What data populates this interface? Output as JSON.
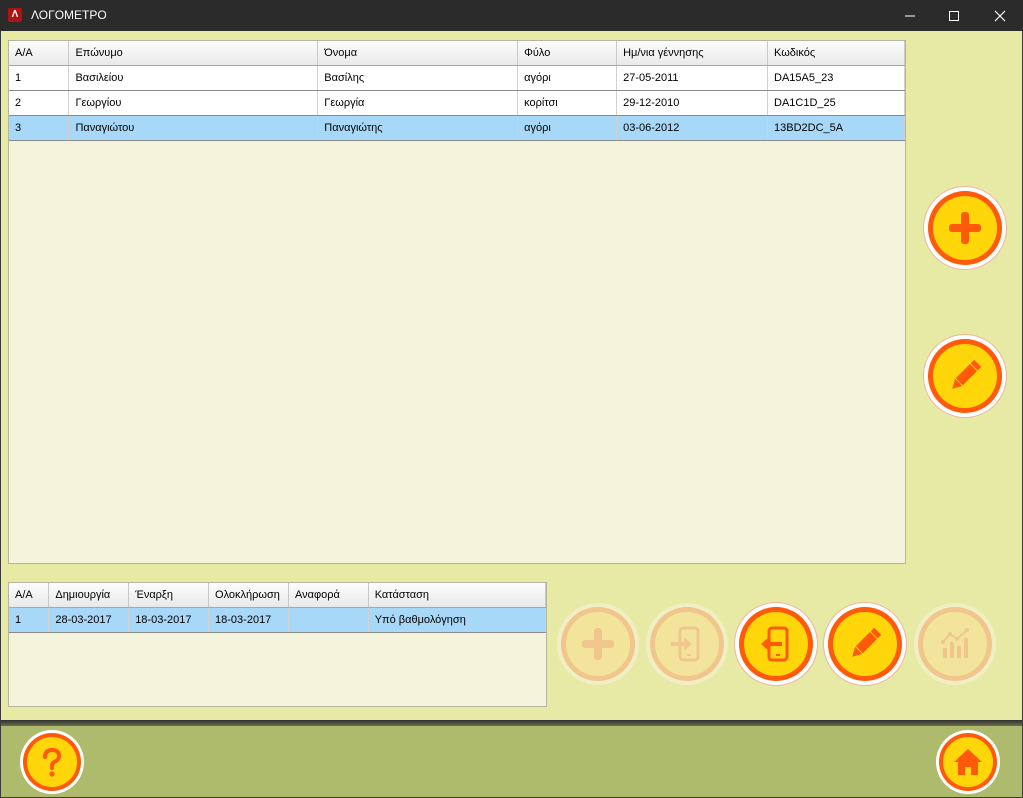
{
  "window": {
    "title": "ΛΟΓΟΜΕΤΡΟ",
    "app_icon_glyph": "Λ",
    "controls": [
      "minimize-icon",
      "maximize-icon",
      "close-icon"
    ]
  },
  "students": {
    "columns": [
      "Α/Α",
      "Επώνυμο",
      "Όνομα",
      "Φύλο",
      "Ημ/νια γέννησης",
      "Κωδικός"
    ],
    "rows": [
      [
        "1",
        "Βασιλείου",
        "Βασίλης",
        "αγόρι",
        "27-05-2011",
        "DA15A5_23"
      ],
      [
        "2",
        "Γεωργίου",
        "Γεωργία",
        "κορίτσι",
        "29-12-2010",
        "DA1C1D_25"
      ],
      [
        "3",
        "Παναγιώτου",
        "Παναγιώτης",
        "αγόρι",
        "03-06-2012",
        "13BD2DC_5A"
      ]
    ],
    "selected_row": 2
  },
  "sessions": {
    "columns": [
      "Α/Α",
      "Δημιουργία",
      "Έναρξη",
      "Ολοκλήρωση",
      "Αναφορά",
      "Κατάσταση"
    ],
    "rows": [
      [
        "1",
        "28-03-2017",
        "18-03-2017",
        "18-03-2017",
        "",
        "Υπό βαθμολόγηση"
      ]
    ],
    "selected_row": 0
  },
  "actions": {
    "add_student": {
      "icon": "plus-icon",
      "enabled": true
    },
    "edit_student": {
      "icon": "pencil-icon",
      "enabled": true
    },
    "add_session": {
      "icon": "plus-icon",
      "enabled": false
    },
    "import_session": {
      "icon": "tablet-import-icon",
      "enabled": false
    },
    "export_session": {
      "icon": "tablet-export-icon",
      "enabled": true
    },
    "edit_session": {
      "icon": "pencil-icon",
      "enabled": true
    },
    "report_session": {
      "icon": "chart-icon",
      "enabled": false
    },
    "help": {
      "icon": "question-icon"
    },
    "home": {
      "icon": "home-icon"
    }
  },
  "colors": {
    "background": "#e6eaa4",
    "footer": "#aeba6c",
    "accent_orange": "#ff5a0a",
    "accent_yellow": "#ffd60a",
    "selection": "#a8d8f8"
  }
}
